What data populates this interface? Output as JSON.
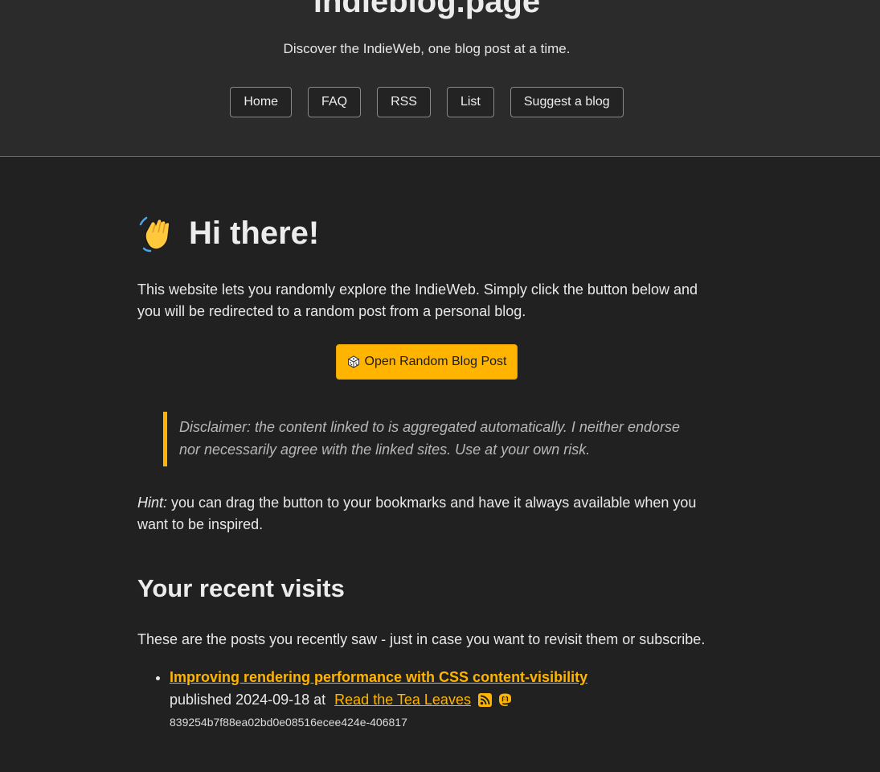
{
  "header": {
    "title": "indieblog.page",
    "tagline": "Discover the IndieWeb, one blog post at a time.",
    "nav": [
      {
        "label": "Home"
      },
      {
        "label": "FAQ"
      },
      {
        "label": "RSS"
      },
      {
        "label": "List"
      },
      {
        "label": "Suggest a blog"
      }
    ]
  },
  "main": {
    "greeting": "Hi there!",
    "wave_icon": "waving-hand-icon",
    "intro": "This website lets you randomly explore the IndieWeb. Simply click the button below and you will be redirected to a random post from a personal blog.",
    "random_button": "Open Random Blog Post",
    "dice_icon": "dice-icon",
    "disclaimer": "Disclaimer: the content linked to is aggregated automatically. I neither endorse nor necessarily agree with the linked sites. Use at your own risk.",
    "hint_label": "Hint:",
    "hint_text": " you can drag the button to your bookmarks and have it always available when you want to be inspired."
  },
  "recent": {
    "title": "Your recent visits",
    "description": "These are the posts you recently saw - just in case you want to revisit them or subscribe.",
    "items": [
      {
        "post_title": "Improving rendering performance with CSS content-visibility",
        "published_prefix": "published 2024-09-18 at ",
        "blog_name": "Read the Tea Leaves",
        "rss_icon": "rss-icon",
        "mastodon_icon": "mastodon-icon",
        "hash": "839254b7f88ea02bd0e08516ecee424e-406817"
      }
    ]
  },
  "colors": {
    "accent": "#ffb400",
    "background": "#212121",
    "header_background": "#2b2b2b"
  }
}
